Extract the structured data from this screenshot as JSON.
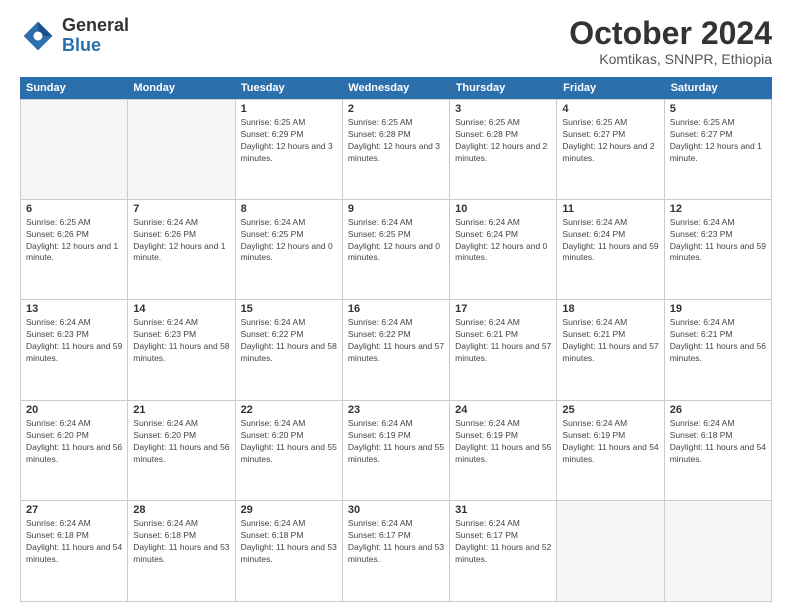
{
  "logo": {
    "general": "General",
    "blue": "Blue"
  },
  "title": "October 2024",
  "subtitle": "Komtikas, SNNPR, Ethiopia",
  "days_of_week": [
    "Sunday",
    "Monday",
    "Tuesday",
    "Wednesday",
    "Thursday",
    "Friday",
    "Saturday"
  ],
  "weeks": [
    [
      {
        "day": "",
        "empty": true
      },
      {
        "day": "",
        "empty": true
      },
      {
        "day": "1",
        "sunrise": "6:25 AM",
        "sunset": "6:29 PM",
        "daylight": "12 hours and 3 minutes."
      },
      {
        "day": "2",
        "sunrise": "6:25 AM",
        "sunset": "6:28 PM",
        "daylight": "12 hours and 3 minutes."
      },
      {
        "day": "3",
        "sunrise": "6:25 AM",
        "sunset": "6:28 PM",
        "daylight": "12 hours and 2 minutes."
      },
      {
        "day": "4",
        "sunrise": "6:25 AM",
        "sunset": "6:27 PM",
        "daylight": "12 hours and 2 minutes."
      },
      {
        "day": "5",
        "sunrise": "6:25 AM",
        "sunset": "6:27 PM",
        "daylight": "12 hours and 1 minute."
      }
    ],
    [
      {
        "day": "6",
        "sunrise": "6:25 AM",
        "sunset": "6:26 PM",
        "daylight": "12 hours and 1 minute."
      },
      {
        "day": "7",
        "sunrise": "6:24 AM",
        "sunset": "6:26 PM",
        "daylight": "12 hours and 1 minute."
      },
      {
        "day": "8",
        "sunrise": "6:24 AM",
        "sunset": "6:25 PM",
        "daylight": "12 hours and 0 minutes."
      },
      {
        "day": "9",
        "sunrise": "6:24 AM",
        "sunset": "6:25 PM",
        "daylight": "12 hours and 0 minutes."
      },
      {
        "day": "10",
        "sunrise": "6:24 AM",
        "sunset": "6:24 PM",
        "daylight": "12 hours and 0 minutes."
      },
      {
        "day": "11",
        "sunrise": "6:24 AM",
        "sunset": "6:24 PM",
        "daylight": "11 hours and 59 minutes."
      },
      {
        "day": "12",
        "sunrise": "6:24 AM",
        "sunset": "6:23 PM",
        "daylight": "11 hours and 59 minutes."
      }
    ],
    [
      {
        "day": "13",
        "sunrise": "6:24 AM",
        "sunset": "6:23 PM",
        "daylight": "11 hours and 59 minutes."
      },
      {
        "day": "14",
        "sunrise": "6:24 AM",
        "sunset": "6:23 PM",
        "daylight": "11 hours and 58 minutes."
      },
      {
        "day": "15",
        "sunrise": "6:24 AM",
        "sunset": "6:22 PM",
        "daylight": "11 hours and 58 minutes."
      },
      {
        "day": "16",
        "sunrise": "6:24 AM",
        "sunset": "6:22 PM",
        "daylight": "11 hours and 57 minutes."
      },
      {
        "day": "17",
        "sunrise": "6:24 AM",
        "sunset": "6:21 PM",
        "daylight": "11 hours and 57 minutes."
      },
      {
        "day": "18",
        "sunrise": "6:24 AM",
        "sunset": "6:21 PM",
        "daylight": "11 hours and 57 minutes."
      },
      {
        "day": "19",
        "sunrise": "6:24 AM",
        "sunset": "6:21 PM",
        "daylight": "11 hours and 56 minutes."
      }
    ],
    [
      {
        "day": "20",
        "sunrise": "6:24 AM",
        "sunset": "6:20 PM",
        "daylight": "11 hours and 56 minutes."
      },
      {
        "day": "21",
        "sunrise": "6:24 AM",
        "sunset": "6:20 PM",
        "daylight": "11 hours and 56 minutes."
      },
      {
        "day": "22",
        "sunrise": "6:24 AM",
        "sunset": "6:20 PM",
        "daylight": "11 hours and 55 minutes."
      },
      {
        "day": "23",
        "sunrise": "6:24 AM",
        "sunset": "6:19 PM",
        "daylight": "11 hours and 55 minutes."
      },
      {
        "day": "24",
        "sunrise": "6:24 AM",
        "sunset": "6:19 PM",
        "daylight": "11 hours and 55 minutes."
      },
      {
        "day": "25",
        "sunrise": "6:24 AM",
        "sunset": "6:19 PM",
        "daylight": "11 hours and 54 minutes."
      },
      {
        "day": "26",
        "sunrise": "6:24 AM",
        "sunset": "6:18 PM",
        "daylight": "11 hours and 54 minutes."
      }
    ],
    [
      {
        "day": "27",
        "sunrise": "6:24 AM",
        "sunset": "6:18 PM",
        "daylight": "11 hours and 54 minutes."
      },
      {
        "day": "28",
        "sunrise": "6:24 AM",
        "sunset": "6:18 PM",
        "daylight": "11 hours and 53 minutes."
      },
      {
        "day": "29",
        "sunrise": "6:24 AM",
        "sunset": "6:18 PM",
        "daylight": "11 hours and 53 minutes."
      },
      {
        "day": "30",
        "sunrise": "6:24 AM",
        "sunset": "6:17 PM",
        "daylight": "11 hours and 53 minutes."
      },
      {
        "day": "31",
        "sunrise": "6:24 AM",
        "sunset": "6:17 PM",
        "daylight": "11 hours and 52 minutes."
      },
      {
        "day": "",
        "empty": true
      },
      {
        "day": "",
        "empty": true
      }
    ]
  ]
}
